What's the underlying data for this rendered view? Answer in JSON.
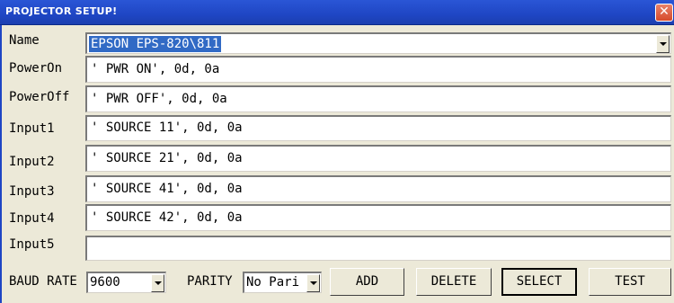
{
  "window": {
    "title": "PROJECTOR SETUP!",
    "close": "✕"
  },
  "fields": [
    {
      "label": "Name",
      "value": "EPSON EPS-820\\811"
    },
    {
      "label": "PowerOn",
      "value": "' PWR ON', 0d, 0a"
    },
    {
      "label": "PowerOff",
      "value": "' PWR OFF', 0d, 0a"
    },
    {
      "label": "Input1",
      "value": "' SOURCE 11', 0d, 0a"
    },
    {
      "label": "Input2",
      "value": "' SOURCE 21', 0d, 0a"
    },
    {
      "label": "Input3",
      "value": "' SOURCE 41', 0d, 0a"
    },
    {
      "label": "Input4",
      "value": "' SOURCE 42', 0d, 0a"
    },
    {
      "label": "Input5",
      "value": ""
    }
  ],
  "bottom": {
    "baud_label": "BAUD RATE",
    "baud_value": "9600",
    "parity_label": "PARITY",
    "parity_value": "No Pari",
    "buttons": {
      "add": "ADD",
      "delete": "DELETE",
      "select": "SELECT",
      "test": "TEST"
    }
  },
  "colors": {
    "titlebar": "#1f46c4",
    "selection": "#316ac5",
    "face": "#ece9d8"
  },
  "icons": {
    "close": "close-icon",
    "dropdown": "chevron-down-icon"
  }
}
